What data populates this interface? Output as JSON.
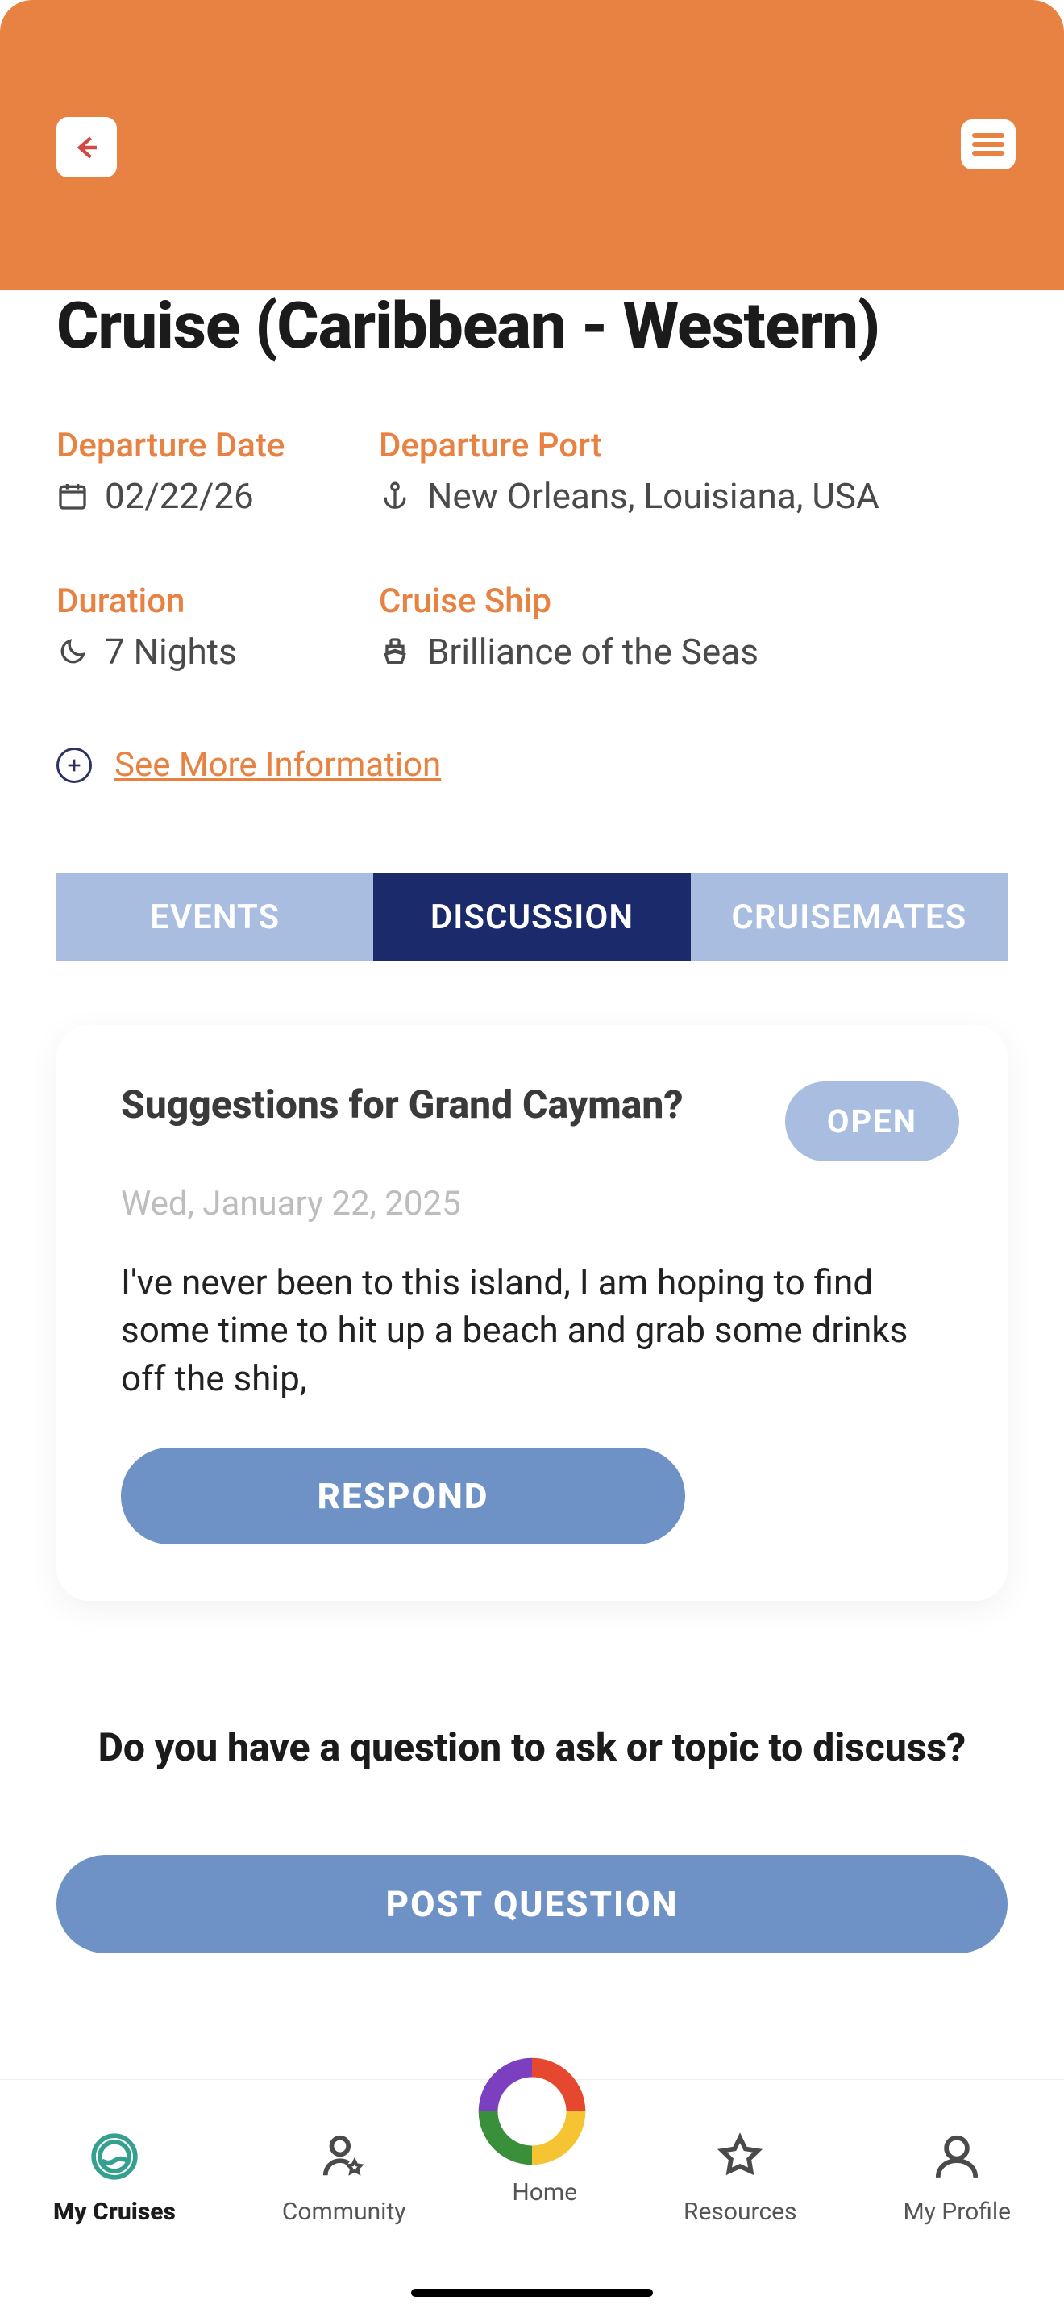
{
  "cruise": {
    "title": "Cruise (Caribbean - Western)",
    "departure_date_label": "Departure Date",
    "departure_date_value": "02/22/26",
    "departure_port_label": "Departure Port",
    "departure_port_value": "New Orleans, Louisiana, USA",
    "duration_label": "Duration",
    "duration_value": "7 Nights",
    "ship_label": "Cruise Ship",
    "ship_value": "Brilliance of the Seas",
    "see_more": "See More Information"
  },
  "tabs": {
    "events": "EVENTS",
    "discussion": "DISCUSSION",
    "cruisemates": "CRUISEMATES"
  },
  "discussion": {
    "title": "Suggestions for Grand Cayman?",
    "status": "OPEN",
    "date": "Wed, January 22, 2025",
    "body": "I've never been to this island, I am hoping to find some time to hit up a beach and grab some drinks off the ship,",
    "respond": "RESPOND"
  },
  "prompt": "Do you have a question to ask or topic to discuss?",
  "post_question": "POST QUESTION",
  "nav": {
    "my_cruises": "My Cruises",
    "community": "Community",
    "home": "Home",
    "resources": "Resources",
    "my_profile": "My Profile"
  }
}
